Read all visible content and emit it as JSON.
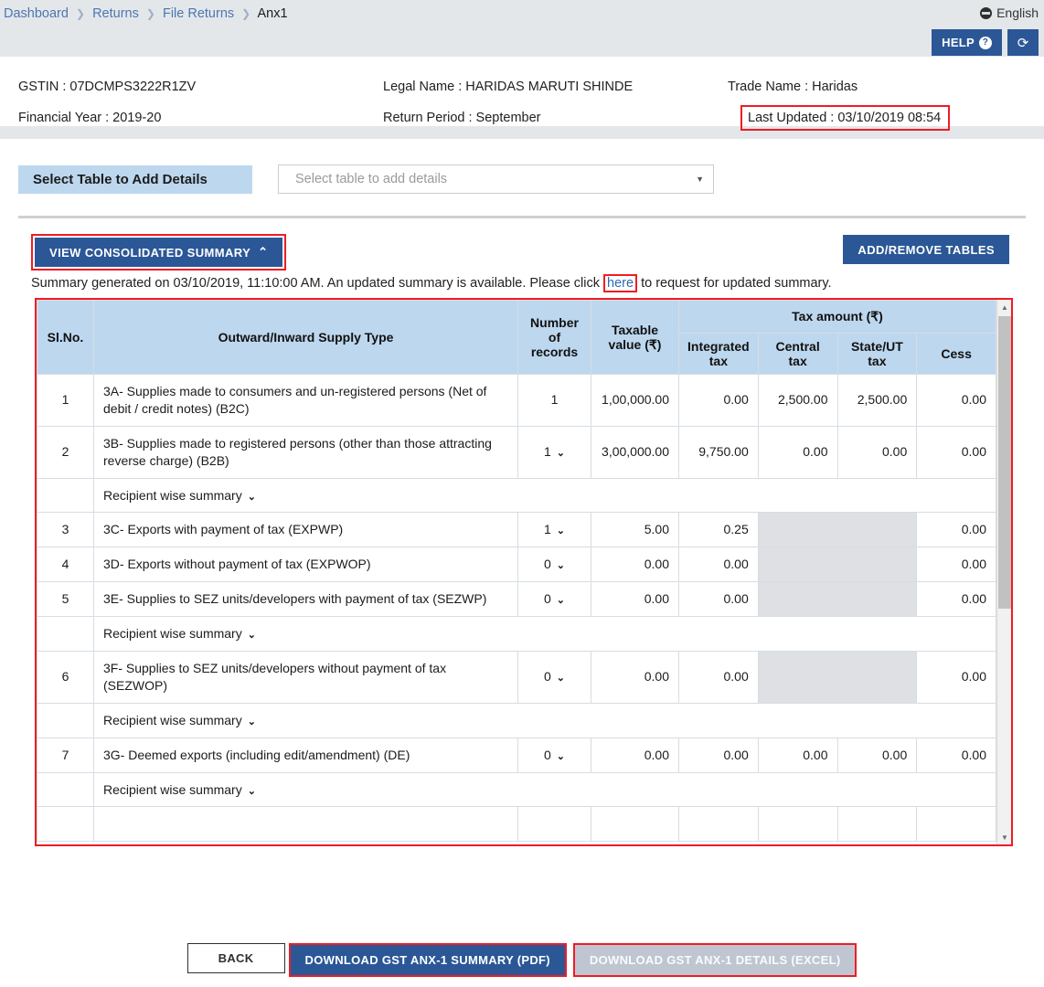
{
  "header": {
    "breadcrumb": [
      "Dashboard",
      "Returns",
      "File Returns",
      "Anx1"
    ],
    "language": "English",
    "help_label": "HELP",
    "help_icon": "question-circle-icon",
    "refresh_icon": "refresh-icon",
    "globe_icon": "globe-icon",
    "accent_blue": "#2b5797",
    "highlight_red": "#ee1c25"
  },
  "taxpayer": {
    "gstin": "GSTIN : 07DCMPS3222R1ZV",
    "legal_name": "Legal Name : HARIDAS MARUTI SHINDE",
    "trade_name": "Trade Name : Haridas",
    "financial_year": "Financial Year : 2019-20",
    "return_period": "Return Period : September",
    "last_updated": "Last Updated : 03/10/2019 08:54"
  },
  "select_table": {
    "label": "Select Table to Add Details",
    "placeholder": "Select table to add details",
    "value": "",
    "caret": "▼"
  },
  "toolbar": {
    "view_summary_label": "VIEW CONSOLIDATED SUMMARY",
    "view_summary_caret": "⌃",
    "add_remove_label": "ADD/REMOVE TABLES"
  },
  "summary_note": {
    "before": "Summary generated on 03/10/2019, 11:10:00 AM. An updated summary is available. Please click",
    "link": "here",
    "after": "to request for updated summary."
  },
  "table": {
    "group_header": "Tax amount (₹)",
    "columns": {
      "sl": "Sl.No.",
      "type": "Outward/Inward Supply Type",
      "records": "Number of records",
      "taxable": "Taxable value (₹)",
      "integrated": "Integrated tax",
      "central": "Central tax",
      "state_ut": "State/UT tax",
      "cess": "Cess"
    },
    "recipient_label": "Recipient wise summary",
    "chevron_down": "⌄",
    "rows": [
      {
        "sl": "1",
        "type": "3A- Supplies made to consumers and un-registered persons (Net of debit / credit notes) (B2C)",
        "records": "1",
        "records_caret": false,
        "taxable": "1,00,000.00",
        "integrated": "0.00",
        "central": "2,500.00",
        "state_ut": "2,500.00",
        "cess": "0.00",
        "disabled_tax": false,
        "recipient_row": false
      },
      {
        "sl": "2",
        "type": "3B- Supplies made to registered persons (other than those attracting reverse charge) (B2B)",
        "records": "1",
        "records_caret": true,
        "taxable": "3,00,000.00",
        "integrated": "9,750.00",
        "central": "0.00",
        "state_ut": "0.00",
        "cess": "0.00",
        "disabled_tax": false,
        "recipient_row": true
      },
      {
        "sl": "3",
        "type": "3C- Exports with payment of tax (EXPWP)",
        "records": "1",
        "records_caret": true,
        "taxable": "5.00",
        "integrated": "0.25",
        "central": "",
        "state_ut": "",
        "cess": "0.00",
        "disabled_tax": true,
        "recipient_row": false
      },
      {
        "sl": "4",
        "type": "3D- Exports without payment of tax (EXPWOP)",
        "records": "0",
        "records_caret": true,
        "taxable": "0.00",
        "integrated": "0.00",
        "central": "",
        "state_ut": "",
        "cess": "0.00",
        "disabled_tax": true,
        "recipient_row": false
      },
      {
        "sl": "5",
        "type": "3E- Supplies to SEZ units/developers with payment of tax (SEZWP)",
        "records": "0",
        "records_caret": true,
        "taxable": "0.00",
        "integrated": "0.00",
        "central": "",
        "state_ut": "",
        "cess": "0.00",
        "disabled_tax": true,
        "recipient_row": true
      },
      {
        "sl": "6",
        "type": "3F- Supplies to SEZ units/developers without payment of tax (SEZWOP)",
        "records": "0",
        "records_caret": true,
        "taxable": "0.00",
        "integrated": "0.00",
        "central": "",
        "state_ut": "",
        "cess": "0.00",
        "disabled_tax": true,
        "recipient_row": true
      },
      {
        "sl": "7",
        "type": "3G- Deemed exports (including edit/amendment) (DE)",
        "records": "0",
        "records_caret": true,
        "taxable": "0.00",
        "integrated": "0.00",
        "central": "0.00",
        "state_ut": "0.00",
        "cess": "0.00",
        "disabled_tax": false,
        "recipient_row": true
      }
    ]
  },
  "footer": {
    "back": "BACK",
    "download_pdf": "DOWNLOAD GST ANX-1 SUMMARY (PDF)",
    "download_excel": "DOWNLOAD GST ANX-1 DETAILS (EXCEL)"
  }
}
